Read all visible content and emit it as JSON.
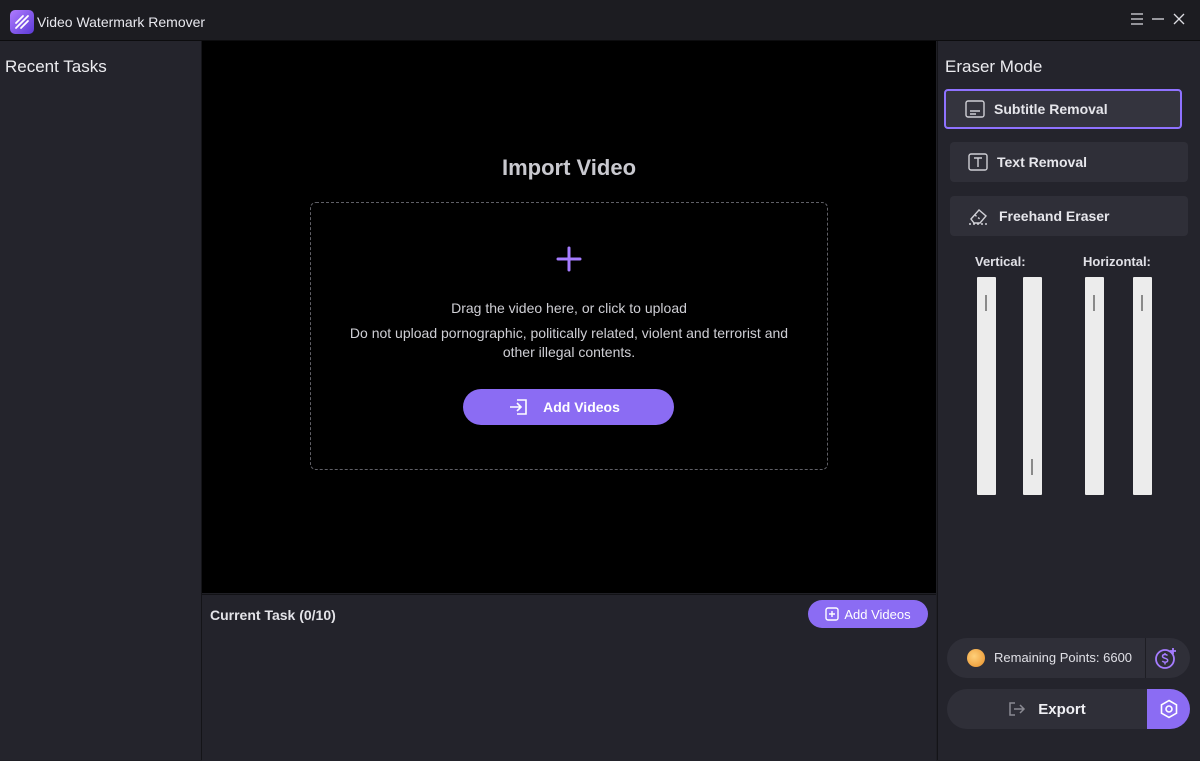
{
  "app": {
    "title": "Video Watermark Remover"
  },
  "sidebar": {
    "title": "Recent Tasks"
  },
  "preview": {
    "title": "Import Video",
    "drop_text": "Drag the video here, or click to upload",
    "warning": "Do not upload pornographic, politically related, violent and terrorist and other illegal contents.",
    "add_button": "Add Videos"
  },
  "tasks": {
    "title": "Current Task (0/10)",
    "add_button": "Add Videos"
  },
  "eraser": {
    "title": "Eraser Mode",
    "modes": [
      {
        "label": "Subtitle Removal",
        "icon": "subtitle-icon",
        "active": true
      },
      {
        "label": "Text Removal",
        "icon": "text-icon",
        "active": false
      },
      {
        "label": "Freehand Eraser",
        "icon": "eraser-icon",
        "active": false
      }
    ],
    "vertical_label": "Vertical:",
    "horizontal_label": "Horizontal:"
  },
  "points": {
    "label": "Remaining Points: 6600"
  },
  "export": {
    "label": "Export"
  },
  "colors": {
    "accent": "#8b6cf3",
    "accent_border": "#8f72ff",
    "background": "#1f1f25",
    "preview_bg": "#000000"
  }
}
